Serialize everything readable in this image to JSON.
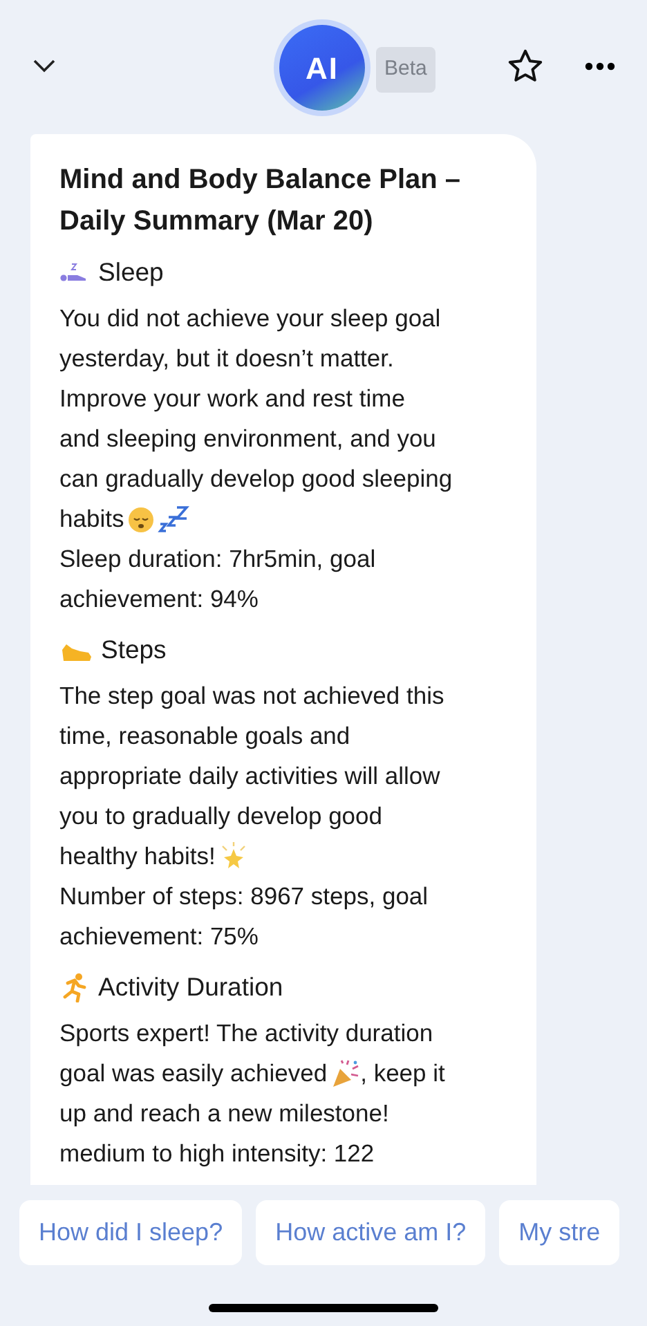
{
  "header": {
    "badge": "Beta",
    "logo": "AI"
  },
  "card": {
    "title": "Mind and Body Balance Plan – Daily Summary (Mar 20)",
    "sections": [
      {
        "kind": "sleep",
        "title": "Sleep",
        "lines": [
          [
            {
              "kind": "text",
              "text": "You did not achieve your sleep goal"
            }
          ],
          [
            {
              "kind": "text",
              "text": "yesterday, but it doesn’t matter."
            }
          ],
          [
            {
              "kind": "text",
              "text": "Improve your work and rest time"
            }
          ],
          [
            {
              "kind": "text",
              "text": "and sleeping environment, and you"
            }
          ],
          [
            {
              "kind": "text",
              "text": "can gradually develop good sleeping"
            }
          ],
          [
            {
              "kind": "text",
              "text": "habits"
            },
            {
              "kind": "sleepy"
            },
            {
              "kind": "zzz"
            }
          ],
          [
            {
              "kind": "text",
              "text": "Sleep duration: 7hr5min, goal"
            }
          ],
          [
            {
              "kind": "text",
              "text": "achievement: 94%"
            }
          ]
        ]
      },
      {
        "kind": "steps",
        "title": "Steps",
        "lines": [
          [
            {
              "kind": "text",
              "text": "The step goal was not achieved this"
            }
          ],
          [
            {
              "kind": "text",
              "text": "time, reasonable goals and"
            }
          ],
          [
            {
              "kind": "text",
              "text": "appropriate daily activities will allow"
            }
          ],
          [
            {
              "kind": "text",
              "text": "you to gradually develop good"
            }
          ],
          [
            {
              "kind": "text",
              "text": "healthy habits!"
            },
            {
              "kind": "sparkle"
            }
          ],
          [
            {
              "kind": "text",
              "text": "Number of steps: 8967 steps, goal"
            }
          ],
          [
            {
              "kind": "text",
              "text": "achievement: 75%"
            }
          ]
        ]
      },
      {
        "kind": "activity",
        "title": "Activity Duration",
        "lines": [
          [
            {
              "kind": "text",
              "text": "Sports expert! The activity duration"
            }
          ],
          [
            {
              "kind": "text",
              "text": "goal was easily achieved"
            },
            {
              "kind": "party"
            },
            {
              "kind": "text",
              "text": ", keep it"
            }
          ],
          [
            {
              "kind": "text",
              "text": "up and reach a new milestone!"
            }
          ],
          [
            {
              "kind": "text",
              "text": "medium to high intensity: 122"
            }
          ]
        ]
      }
    ]
  },
  "suggestions": [
    {
      "text": "How did I sleep?"
    },
    {
      "text": "How active am I?"
    },
    {
      "text": "My stre"
    }
  ]
}
